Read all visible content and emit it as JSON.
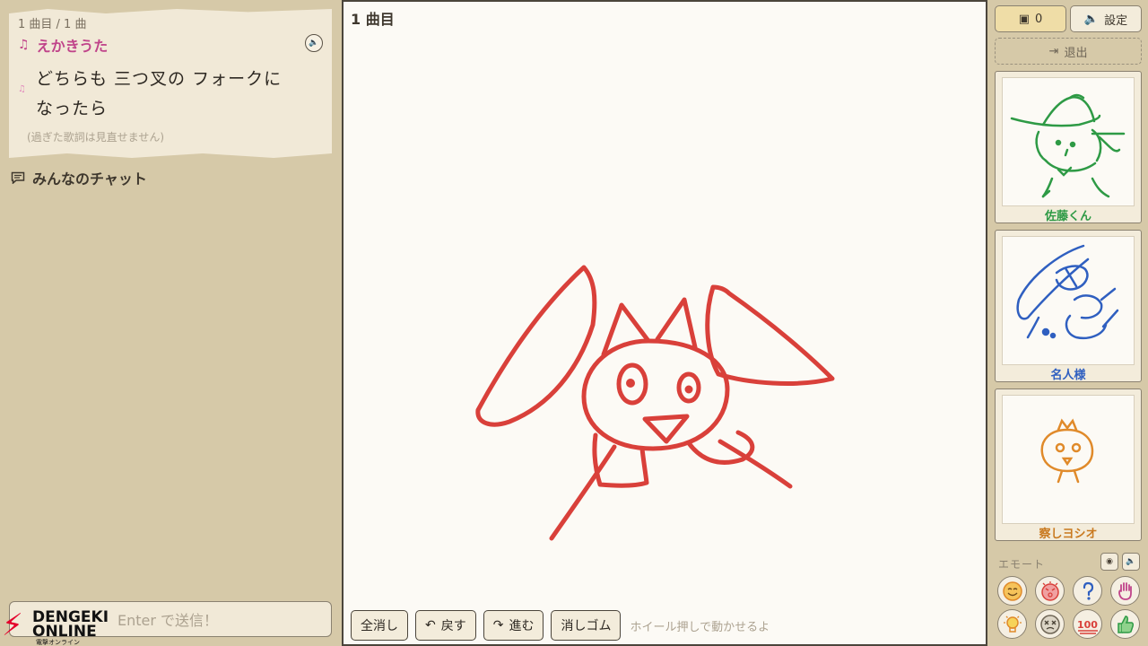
{
  "lyrics": {
    "song_count": "1 曲目 / 1 曲",
    "song_title": "えかきうた",
    "lines": [
      "どちらも 三つ叉の フォークに",
      "なったら"
    ],
    "hint": "(過ぎた歌詞は見直せません)"
  },
  "chat": {
    "title": "みんなのチャット",
    "placeholder": "Enter で送信！"
  },
  "logo": {
    "line1": "DENGEKI",
    "line2": "ONLINE",
    "line3": "電撃オンライン"
  },
  "canvas": {
    "round_label": "1 曲目",
    "stroke_color": "#d9403a",
    "tools": {
      "clear": "全消し",
      "undo": "戻す",
      "redo": "進む",
      "eraser": "消しゴム"
    },
    "hint": "ホイール押しで動かせるよ"
  },
  "top_controls": {
    "viewer_count": "0",
    "settings": "設定",
    "exit": "退出"
  },
  "players": [
    {
      "name": "佐藤くん",
      "color": "#2e9a45"
    },
    {
      "name": "名人様",
      "color": "#2f5fc0"
    },
    {
      "name": "察しヨシオ",
      "color": "#e08a2a"
    }
  ],
  "emotes": {
    "label": "エモート",
    "icons": [
      "smile-emote-icon",
      "angry-emote-icon",
      "question-emote-icon",
      "hand-emote-icon",
      "lightbulb-emote-icon",
      "dizzy-emote-icon",
      "hundred-emote-icon",
      "thumbs-up-emote-icon"
    ],
    "colors": {
      "orange": "#e08a2a",
      "red": "#d9403a",
      "blue": "#2f5fc0",
      "pink": "#c0448a",
      "green": "#2e9a45",
      "gray": "#6e6556"
    }
  }
}
